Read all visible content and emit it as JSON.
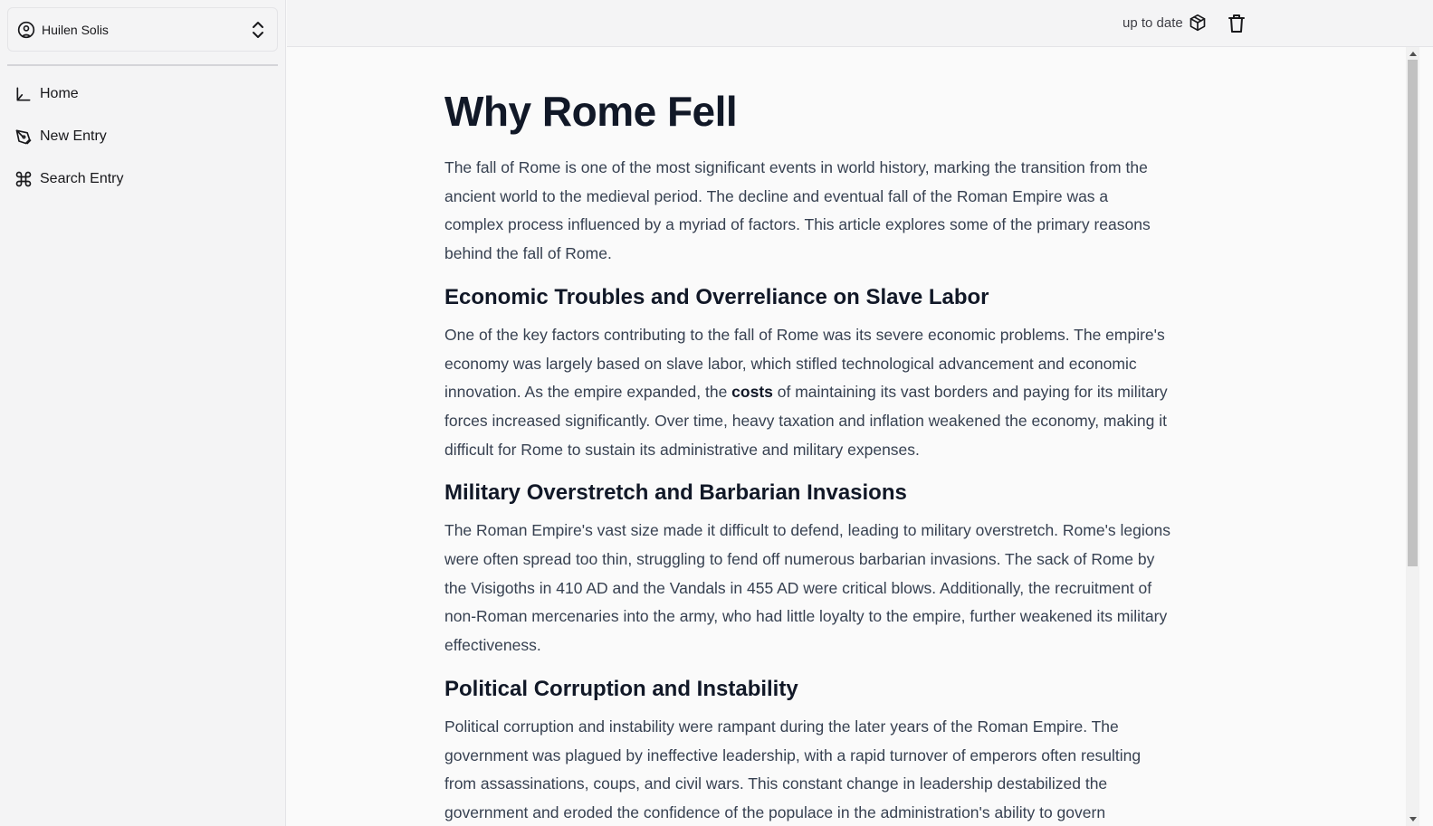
{
  "sidebar": {
    "user": {
      "name": "Huilen Solis",
      "icon": "user-circle-icon",
      "toggle_icon": "chevrons-up-down-icon"
    },
    "items": [
      {
        "label": "Home",
        "icon": "chart-axis-icon"
      },
      {
        "label": "New Entry",
        "icon": "pen-tool-icon"
      },
      {
        "label": "Search Entry",
        "icon": "command-icon"
      }
    ]
  },
  "topbar": {
    "status_text": "up to date",
    "status_icon": "package-icon",
    "delete_icon": "trash-icon"
  },
  "article": {
    "title": "Why Rome Fell",
    "intro": "The fall of Rome is one of the most significant events in world history, marking the transition from the ancient world to the medieval period. The decline and eventual fall of the Roman Empire was a complex process influenced by a myriad of factors. This article explores some of the primary reasons behind the fall of Rome.",
    "sections": [
      {
        "heading": "Economic Troubles and Overreliance on Slave Labor",
        "body_before": "One of the key factors contributing to the fall of Rome was its severe economic problems. The empire's economy was largely based on slave labor, which stifled technological advancement and economic innovation. As the empire expanded, the ",
        "body_bold": "costs",
        "body_after": " of maintaining its vast borders and paying for its military forces increased significantly. Over time, heavy taxation and inflation weakened the economy, making it difficult for Rome to sustain its administrative and military expenses."
      },
      {
        "heading": "Military Overstretch and Barbarian Invasions",
        "body": "The Roman Empire's vast size made it difficult to defend, leading to military overstretch. Rome's legions were often spread too thin, struggling to fend off numerous barbarian invasions. The sack of Rome by the Visigoths in 410 AD and the Vandals in 455 AD were critical blows. Additionally, the recruitment of non-Roman mercenaries into the army, who had little loyalty to the empire, further weakened its military effectiveness."
      },
      {
        "heading": "Political Corruption and Instability",
        "body": "Political corruption and instability were rampant during the later years of the Roman Empire. The government was plagued by ineffective leadership, with a rapid turnover of emperors often resulting from assassinations, coups, and civil wars. This constant change in leadership destabilized the government and eroded the confidence of the populace in the administration's ability to govern"
      }
    ]
  },
  "colors": {
    "sidebar_bg": "#f4f4f5",
    "content_bg": "#fafafa",
    "heading": "#111827",
    "body_text": "#374151"
  }
}
